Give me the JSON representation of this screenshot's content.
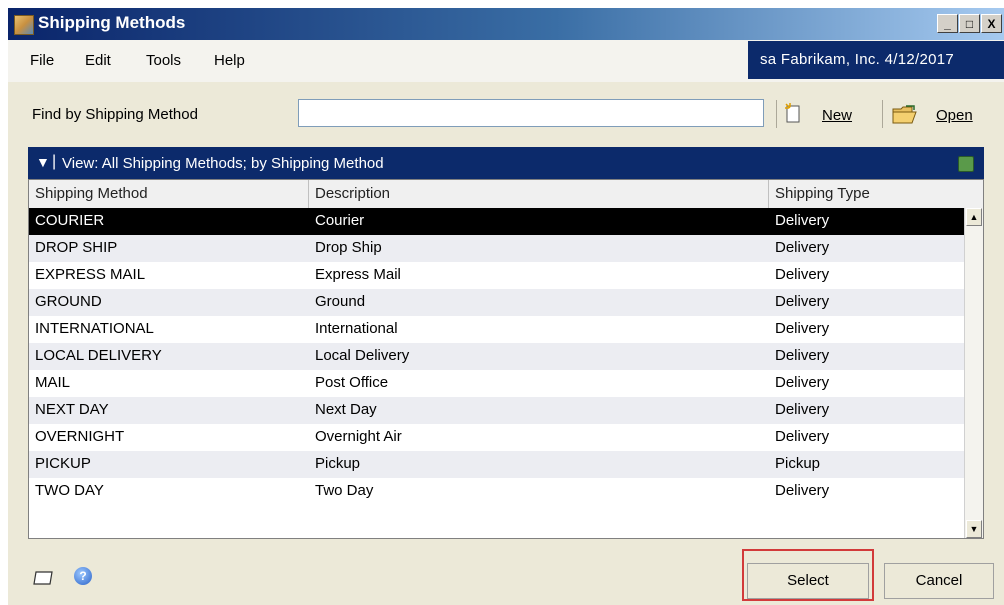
{
  "window": {
    "title": "Shipping Methods",
    "controls": {
      "minimize": "_",
      "maximize": "□",
      "close": "X"
    }
  },
  "menu": {
    "items": [
      "File",
      "Edit",
      "Tools",
      "Help"
    ],
    "company_info": "sa  Fabrikam, Inc.  4/12/2017"
  },
  "find": {
    "label": "Find by Shipping Method",
    "value": "",
    "new_label": "New",
    "open_label": "Open"
  },
  "view": {
    "text": "View: All Shipping Methods; by Shipping Method"
  },
  "grid": {
    "columns": [
      "Shipping Method",
      "Description",
      "Shipping Type"
    ],
    "rows": [
      [
        "COURIER",
        "Courier",
        "Delivery"
      ],
      [
        "DROP SHIP",
        "Drop Ship",
        "Delivery"
      ],
      [
        "EXPRESS MAIL",
        "Express Mail",
        "Delivery"
      ],
      [
        "GROUND",
        "Ground",
        "Delivery"
      ],
      [
        "INTERNATIONAL",
        "International",
        "Delivery"
      ],
      [
        "LOCAL DELIVERY",
        "Local Delivery",
        "Delivery"
      ],
      [
        "MAIL",
        "Post Office",
        "Delivery"
      ],
      [
        "NEXT DAY",
        "Next Day",
        "Delivery"
      ],
      [
        "OVERNIGHT",
        "Overnight Air",
        "Delivery"
      ],
      [
        "PICKUP",
        "Pickup",
        "Pickup"
      ],
      [
        "TWO DAY",
        "Two Day",
        "Delivery"
      ]
    ],
    "selected_index": 0
  },
  "footer": {
    "select_label": "Select",
    "cancel_label": "Cancel"
  },
  "colors": {
    "title_bar": "#0a246a",
    "company_bar": "#0c2a6b",
    "view_bar": "#0c2a6b",
    "selected_row": "#000000",
    "highlight_outline": "#d23a3a"
  },
  "icons": {
    "app": "app-icon",
    "new": "new-document-icon",
    "open": "open-folder-icon",
    "refresh": "refresh-icon",
    "note": "note-icon",
    "help": "help-icon"
  }
}
